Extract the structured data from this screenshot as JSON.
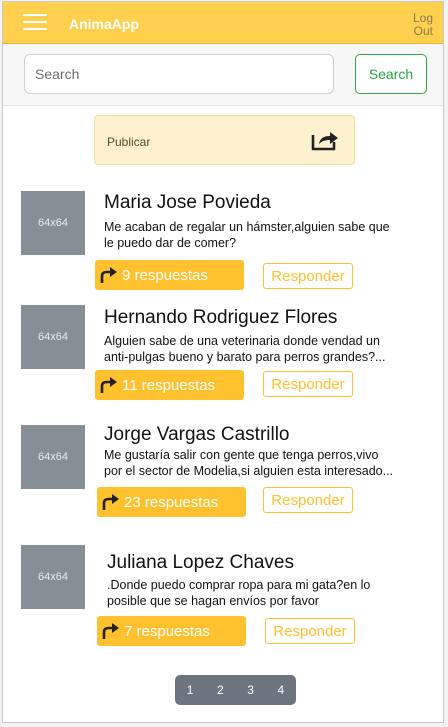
{
  "header": {
    "brand": "AnimaApp",
    "logout_line1": "Log",
    "logout_line2": "Out"
  },
  "search": {
    "placeholder": "Search",
    "button_label": "Search"
  },
  "publish": {
    "label": "Publicar"
  },
  "posts": [
    {
      "thumb": "64x64",
      "name": "Maria Jose Povieda",
      "text": "Me acaban de regalar un hámster,alguien sabe que\n le puedo dar de comer?",
      "replies": "9 respuestas",
      "respond": "Responder"
    },
    {
      "thumb": "64x64",
      "name": "Hernando Rodriguez Flores",
      "text": "Alguien sabe de una veterinaria donde vendad un\nanti-pulgas bueno y barato para perros grandes?...",
      "replies": "11 respuestas",
      "respond": "Responder"
    },
    {
      "thumb": "64x64",
      "name": "Jorge Vargas Castrillo",
      "text": "Me gustaría salir con gente que tenga perros,vivo\n por el sector de Modelia,si alguien esta interesado...",
      "replies": "23 respuestas",
      "respond": "Responder"
    },
    {
      "thumb": "64x64",
      "name": "Juliana Lopez Chaves",
      "text": ".Donde puedo comprar  ropa para mi gata?en lo\nposible que se hagan envíos por favor",
      "replies": "7 respuestas",
      "respond": "Responder"
    }
  ],
  "pagination": [
    "1",
    "2",
    "3",
    "4"
  ],
  "colors": {
    "header": "#ffd04d",
    "accent": "#ffc12e",
    "success": "#28a745",
    "placeholder_thumb": "#868e96"
  },
  "icons": {
    "menu": "hamburger-icon",
    "publish": "share-icon",
    "reply": "reply-arrow-icon"
  }
}
